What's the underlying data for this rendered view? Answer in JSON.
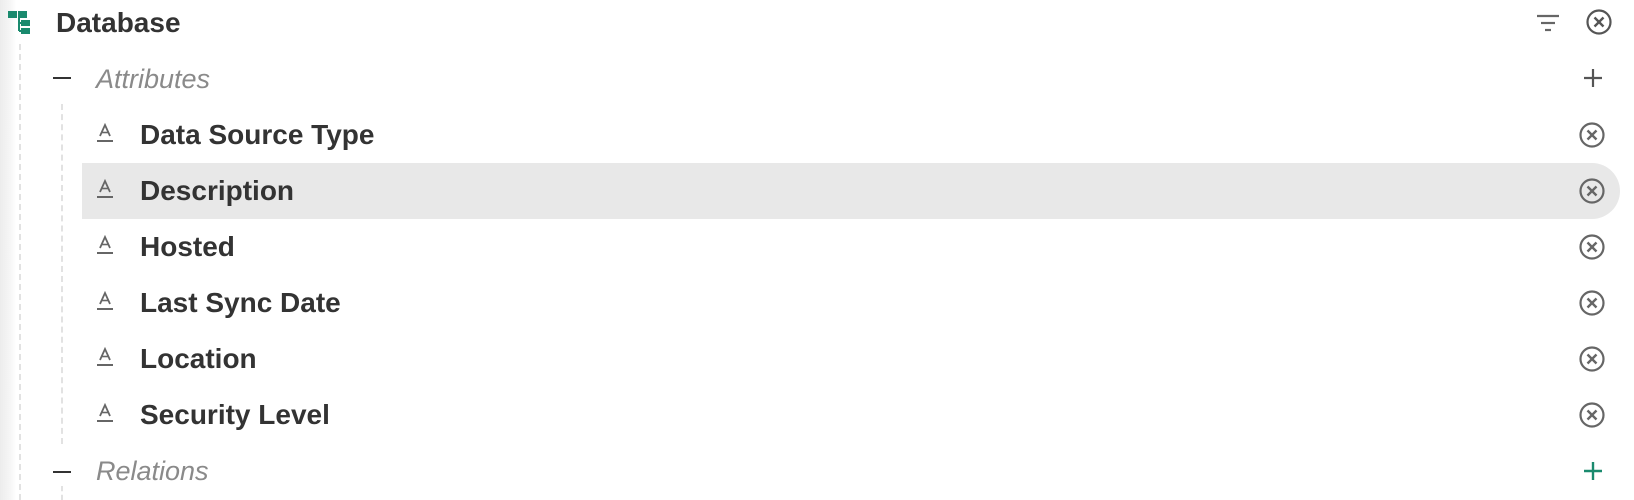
{
  "header": {
    "title": "Database",
    "icon": "tree-structure-icon",
    "actions": [
      "filter-icon",
      "close-circle-icon"
    ]
  },
  "colors": {
    "brand_green": "#1a8a6e",
    "text": "#333333",
    "muted": "#8a8a8a",
    "selected_bg": "#e8e8e8",
    "icon_gray": "#666666"
  },
  "attributes_section": {
    "label": "Attributes",
    "items": [
      {
        "label": "Data Source Type",
        "icon": "text-attribute-icon",
        "selected": false
      },
      {
        "label": "Description",
        "icon": "text-attribute-icon",
        "selected": true
      },
      {
        "label": "Hosted",
        "icon": "text-attribute-icon",
        "selected": false
      },
      {
        "label": "Last Sync Date",
        "icon": "text-attribute-icon",
        "selected": false
      },
      {
        "label": "Location",
        "icon": "text-attribute-icon",
        "selected": false
      },
      {
        "label": "Security Level",
        "icon": "text-attribute-icon",
        "selected": false
      }
    ]
  },
  "relations_section": {
    "label": "Relations"
  }
}
